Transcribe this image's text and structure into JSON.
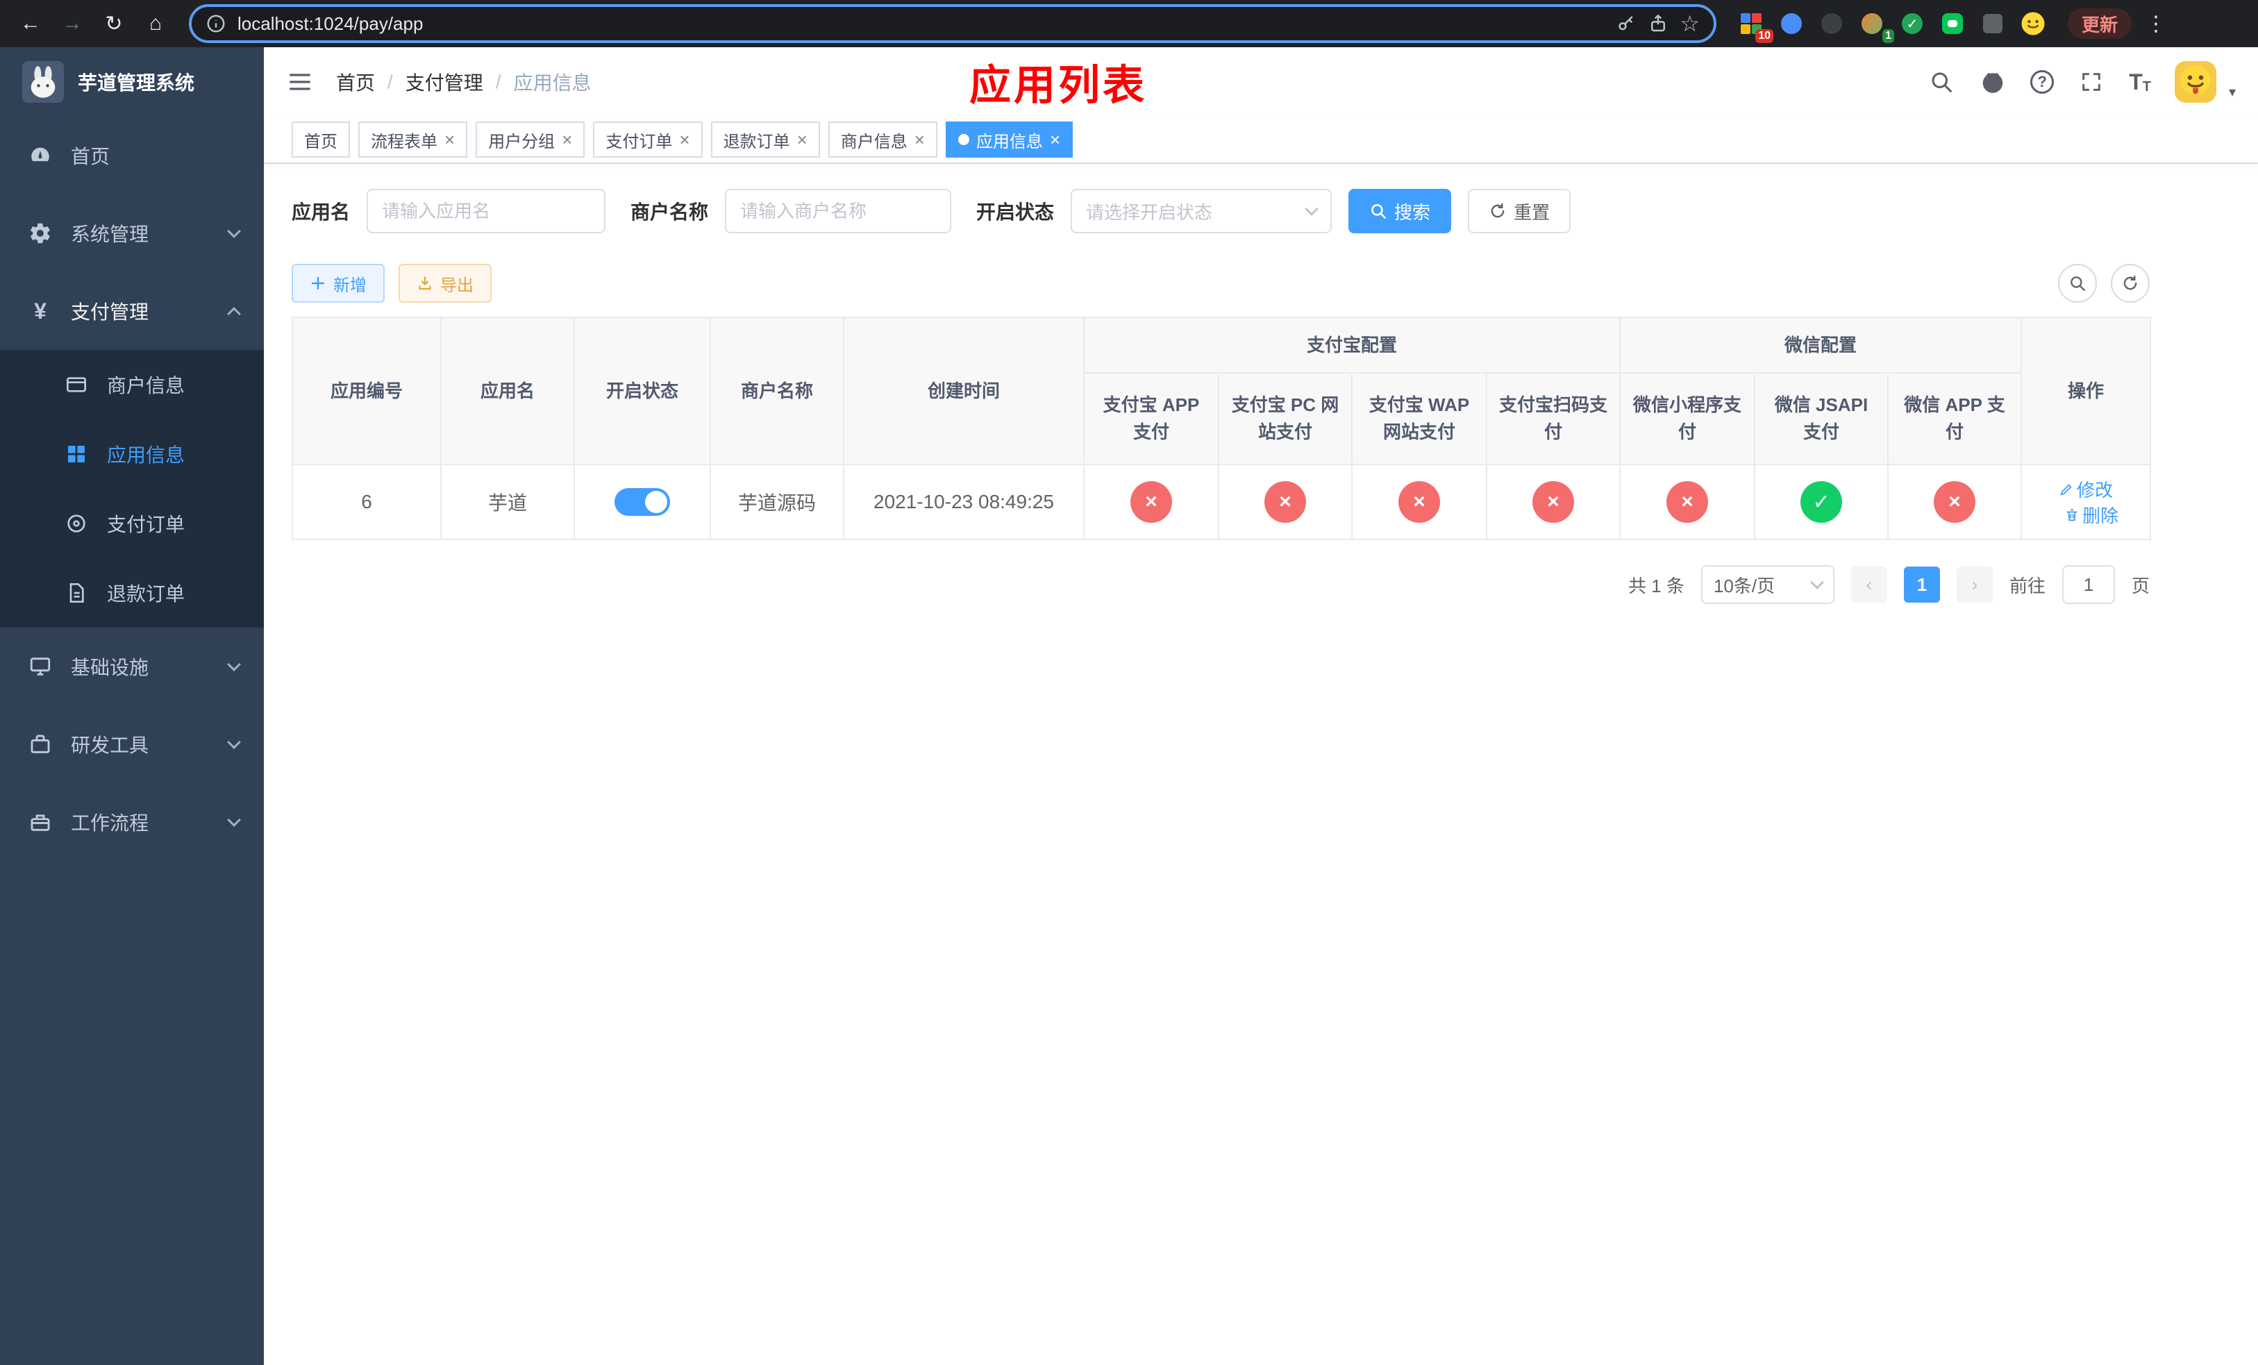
{
  "glyphs": {
    "back": "←",
    "forward": "→",
    "reload": "↻",
    "home": "⌂",
    "star": "☆",
    "kebab": "⋮",
    "close": "×",
    "check": "✓",
    "prev": "‹",
    "next": "›",
    "caret": "▾",
    "question": "?",
    "yen": "¥",
    "font_letter": "T",
    "slash": "/"
  },
  "browser": {
    "url": "localhost:1024/pay/app",
    "update_label": "更新",
    "ext_badge": "10",
    "avatar_badge": "1"
  },
  "sidebar": {
    "title": "芋道管理系统",
    "menu": {
      "home": "首页",
      "system": "系统管理",
      "pay": "支付管理",
      "infra": "基础设施",
      "devtools": "研发工具",
      "workflow": "工作流程"
    },
    "submenu": {
      "merchant": "商户信息",
      "app": "应用信息",
      "order": "支付订单",
      "refund": "退款订单"
    }
  },
  "header": {
    "breadcrumb": [
      "首页",
      "支付管理",
      "应用信息"
    ],
    "annotation": "应用列表"
  },
  "tabs": [
    {
      "label": "首页"
    },
    {
      "label": "流程表单"
    },
    {
      "label": "用户分组"
    },
    {
      "label": "支付订单"
    },
    {
      "label": "退款订单"
    },
    {
      "label": "商户信息"
    },
    {
      "label": "应用信息"
    }
  ],
  "filters": {
    "app_name": {
      "label": "应用名",
      "placeholder": "请输入应用名"
    },
    "merchant": {
      "label": "商户名称",
      "placeholder": "请输入商户名称"
    },
    "status": {
      "label": "开启状态",
      "placeholder": "请选择开启状态"
    },
    "search": "搜索",
    "reset": "重置"
  },
  "toolbar": {
    "add": "新增",
    "export": "导出"
  },
  "table": {
    "groups": {
      "alipay": "支付宝配置",
      "wechat": "微信配置"
    },
    "columns": {
      "id": "应用编号",
      "name": "应用名",
      "status": "开启状态",
      "merchant": "商户名称",
      "created": "创建时间",
      "alipay_app": "支付宝 APP 支付",
      "alipay_pc": "支付宝 PC 网站支付",
      "alipay_wap": "支付宝 WAP 网站支付",
      "alipay_qr": "支付宝扫码支付",
      "wx_mini": "微信小程序支付",
      "wx_jsapi": "微信 JSAPI 支付",
      "wx_app": "微信 APP 支付",
      "actions": "操作"
    },
    "rows": [
      {
        "id": "6",
        "name": "芋道",
        "status": "on",
        "merchant": "芋道源码",
        "created": "2021-10-23 08:49:25",
        "alipay_app": "off",
        "alipay_pc": "off",
        "alipay_wap": "off",
        "alipay_qr": "off",
        "wx_mini": "off",
        "wx_jsapi": "on",
        "wx_app": "off",
        "edit": "修改",
        "delete": "删除"
      }
    ]
  },
  "pagination": {
    "total": "共 1 条",
    "page_size": "10条/页",
    "page": "1",
    "goto": "前往",
    "goto_value": "1",
    "unit": "页"
  },
  "colors": {
    "primary": "#409eff",
    "danger": "#f56c6c",
    "success": "#13ce66",
    "annotation": "#ff0000",
    "sidebar_bg": "#304156",
    "submenu_bg": "#1f2d3d"
  }
}
